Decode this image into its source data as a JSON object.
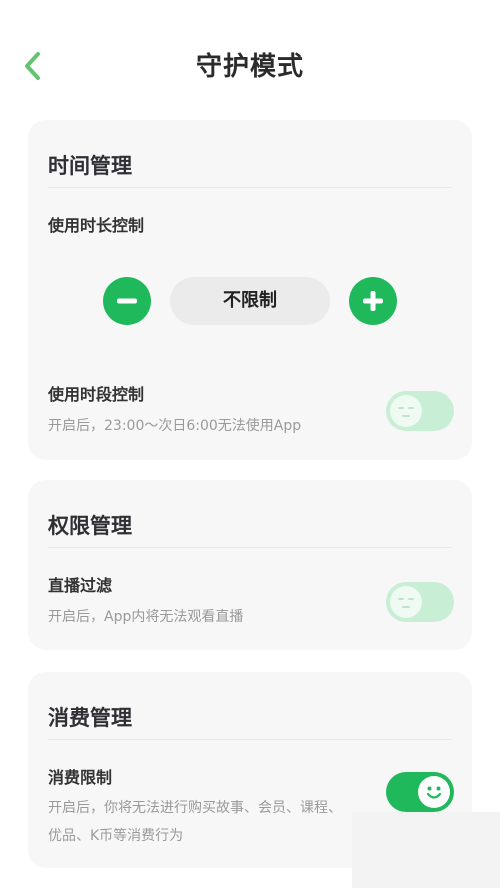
{
  "header": {
    "title": "守护模式",
    "back_icon": "chevron-left-icon",
    "accent": "#1fb85a"
  },
  "time_section": {
    "title": "时间管理",
    "duration_label": "使用时长控制",
    "duration_value": "不限制",
    "minus_icon": "minus-icon",
    "plus_icon": "plus-icon",
    "period_label": "使用时段控制",
    "period_desc": "开启后，23:00～次日6:00无法使用App",
    "period_toggle": "off"
  },
  "permission_section": {
    "title": "权限管理",
    "live_label": "直播过滤",
    "live_desc": "开启后，App内将无法观看直播",
    "live_toggle": "off"
  },
  "consume_section": {
    "title": "消费管理",
    "limit_label": "消费限制",
    "limit_desc_line1": "开启后，你将无法进行购买故事、会员、课程、",
    "limit_desc_line2": "优品、K币等消费行为",
    "limit_toggle": "on"
  }
}
